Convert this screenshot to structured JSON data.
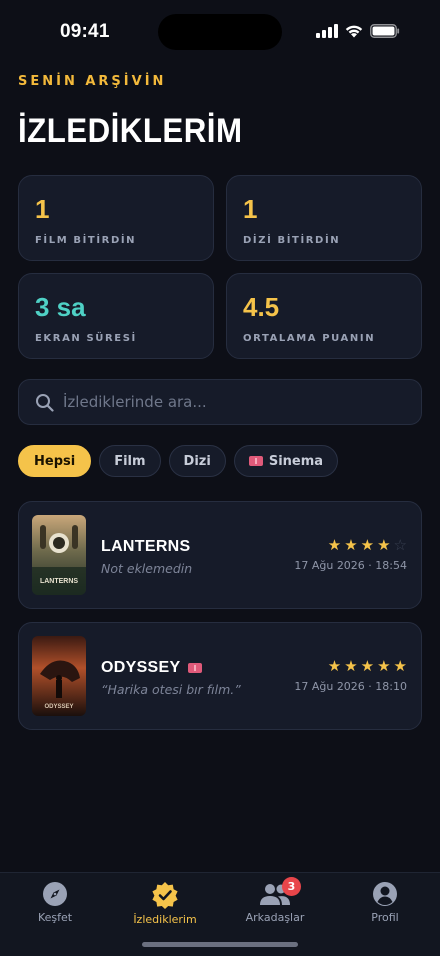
{
  "status_bar": {
    "time": "09:41"
  },
  "header": {
    "eyebrow": "SENİN ARŞİVİN",
    "title": "İZLEDİKLERİM"
  },
  "stats": [
    {
      "value": "1",
      "label": "FİLM BİTİRDİN",
      "color": "#f5c34a"
    },
    {
      "value": "1",
      "label": "DİZİ BİTİRDİN",
      "color": "#f5c34a"
    },
    {
      "value": "3 sa",
      "label": "EKRAN SÜRESİ",
      "color": "#4fd1c5"
    },
    {
      "value": "4.5",
      "label": "ORTALAMA PUANIN",
      "color": "#f5c34a"
    }
  ],
  "search": {
    "placeholder": "İzlediklerinde ara..."
  },
  "filters": [
    {
      "label": "Hepsi",
      "active": true
    },
    {
      "label": "Film",
      "active": false
    },
    {
      "label": "Dizi",
      "active": false
    },
    {
      "label": "Sinema",
      "active": false,
      "icon": "ticket-icon"
    }
  ],
  "entries": [
    {
      "title": "LANTERNS",
      "note": "Not eklemedin",
      "rating": 4,
      "max_rating": 5,
      "date": "17 Ağu 2026 · 18:54",
      "poster_text": "LANTERNS",
      "cinema": false
    },
    {
      "title": "ODYSSEY",
      "note": "“Harika otesi bır fılm.”",
      "rating": 5,
      "max_rating": 5,
      "date": "17 Ağu 2026 · 18:10",
      "poster_text": "ODYSSEY",
      "cinema": true
    }
  ],
  "tabbar": [
    {
      "label": "Keşfet",
      "icon": "compass-icon",
      "active": false
    },
    {
      "label": "İzlediklerim",
      "icon": "check-badge-icon",
      "active": true
    },
    {
      "label": "Arkadaşlar",
      "icon": "friends-icon",
      "active": false,
      "badge": "3"
    },
    {
      "label": "Profil",
      "icon": "profile-icon",
      "active": false
    }
  ],
  "colors": {
    "accent": "#f5c34a",
    "teal": "#4fd1c5",
    "background": "#0d0f17",
    "card": "#161b29"
  }
}
